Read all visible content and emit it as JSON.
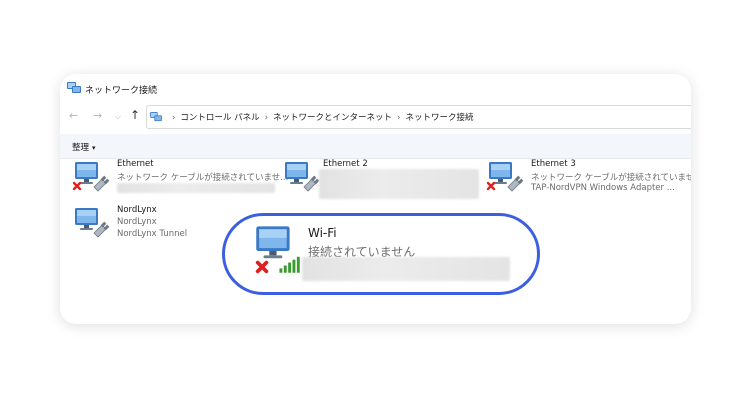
{
  "window": {
    "title": "ネットワーク接続"
  },
  "address": {
    "breadcrumbs": [
      "コントロール パネル",
      "ネットワークとインターネット",
      "ネットワーク接続"
    ],
    "separator": "›"
  },
  "nav_icons": {
    "back": "←",
    "forward": "→",
    "history": "⌵",
    "up": "↑"
  },
  "toolbar": {
    "organize_label": "整理",
    "organize_caret": "▾"
  },
  "connections": [
    {
      "name": "Ethernet",
      "status": "ネットワーク ケーブルが接続されていませ...",
      "device": "",
      "disconnected": true
    },
    {
      "name": "Ethernet 2",
      "status": "",
      "device": "",
      "disconnected": false
    },
    {
      "name": "Ethernet 3",
      "status": "ネットワーク ケーブルが接続されていませ...",
      "device": "TAP-NordVPN Windows Adapter ...",
      "disconnected": true
    },
    {
      "name": "NordLynx",
      "status": "NordLynx",
      "device": "NordLynx Tunnel",
      "disconnected": false
    },
    {
      "name": "Wi-Fi",
      "status": "接続されていません",
      "device": "",
      "disconnected": true
    }
  ],
  "colors": {
    "highlight_ring": "#3b5fe0",
    "disconnected_x": "#e02020",
    "signal_bars": "#3a9a2e"
  },
  "icons": [
    "network-connection-icon",
    "red-x-icon",
    "cable-plug-icon",
    "wifi-signal-icon"
  ]
}
